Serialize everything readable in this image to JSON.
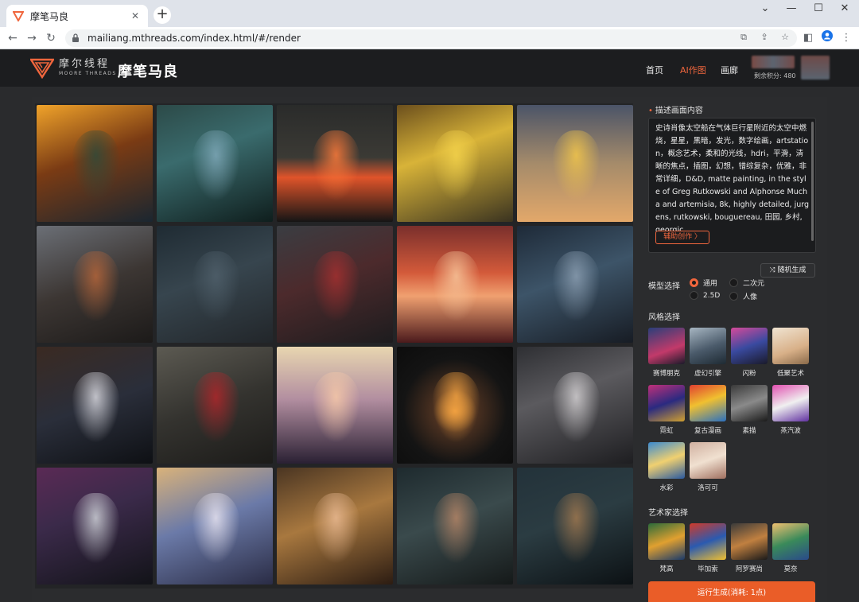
{
  "browser": {
    "tab_title": "摩笔马良",
    "url": "mailiang.mthreads.com/index.html/#/render",
    "new_tab": "+",
    "close": "✕"
  },
  "header": {
    "logo_cn": "摩尔线程",
    "logo_en": "MOORE THREADS",
    "brand": "摩笔马良",
    "nav": [
      "首页",
      "AI作图",
      "画廊"
    ],
    "active_nav": "AI作图",
    "points": "剩余积分: 480"
  },
  "gallery": {
    "tiles": [
      {
        "name": "spaceship-lady",
        "bg": "linear-gradient(160deg,#f0a32a 0%,#7a3b14 45%,#1a2630 100%)",
        "accent": "#2f4a3a"
      },
      {
        "name": "blue-hair-elf",
        "bg": "linear-gradient(160deg,#2c4a48 0%,#3a6b6d 40%,#0f1e1d 100%)",
        "accent": "#7fa8b8"
      },
      {
        "name": "burning-city",
        "bg": "linear-gradient(180deg,#2a2b2a 0%,#3b3a35 45%,#e0542a 62%,#151515 100%)",
        "accent": "#ff7b3a"
      },
      {
        "name": "yellow-robots",
        "bg": "linear-gradient(160deg,#6b4f1d 0%,#d8b338 40%,#3a3320 100%)",
        "accent": "#f3d24b"
      },
      {
        "name": "golden-tree",
        "bg": "linear-gradient(180deg,#4b5468 0%,#a58b6a 50%,#e3a86a 100%)",
        "accent": "#f3c64a"
      },
      {
        "name": "deer-girl",
        "bg": "linear-gradient(160deg,#6b6f76 0%,#3c3633 50%,#1c1a19 100%)",
        "accent": "#b4653a"
      },
      {
        "name": "beanie-girl",
        "bg": "linear-gradient(160deg,#1f2b33 0%,#37454e 45%,#22262a 100%)",
        "accent": "#4f5f6a"
      },
      {
        "name": "red-armor-hero",
        "bg": "linear-gradient(160deg,#3a3d42 0%,#4c2a2c 45%,#1d1c1e 100%)",
        "accent": "#a33030"
      },
      {
        "name": "red-forest",
        "bg": "linear-gradient(180deg,#7a2f2c 0%,#d35a3a 40%,#f0a070 60%,#4b1a1c 100%)",
        "accent": "#f6c59a"
      },
      {
        "name": "space-woman",
        "bg": "linear-gradient(160deg,#1e2a38 0%,#3d5468 45%,#171c24 100%)",
        "accent": "#8a9db0"
      },
      {
        "name": "raccoon",
        "bg": "linear-gradient(160deg,#3a2a22 0%,#2a2e3a 50%,#0e1014 100%)",
        "accent": "#d9d9e0"
      },
      {
        "name": "armored-cat",
        "bg": "linear-gradient(160deg,#5c5a52 0%,#34332f 50%,#1c1b19 100%)",
        "accent": "#b0262a"
      },
      {
        "name": "hourglass",
        "bg": "linear-gradient(180deg,#e8d6b0 0%,#b28ea0 45%,#2a2033 100%)",
        "accent": "#f7c9a8"
      },
      {
        "name": "portal-dial",
        "bg": "radial-gradient(circle at 50% 55%,#f0a040 0%,#4a3020 25%,#141414 60%,#0c0c0c 100%)",
        "accent": "#f0a040"
      },
      {
        "name": "silver-hair-knight",
        "bg": "linear-gradient(160deg,#2e2f33 0%,#5b5a5e 40%,#1e1e21 100%)",
        "accent": "#d3d0d2"
      },
      {
        "name": "silver-hair-man",
        "bg": "linear-gradient(160deg,#5a2a55 0%,#3b2a4a 40%,#121318 100%)",
        "accent": "#cfd2d8"
      },
      {
        "name": "window-elf",
        "bg": "linear-gradient(160deg,#d9b27a 0%,#6b7aa8 45%,#2a2c45 100%)",
        "accent": "#e8e4f0"
      },
      {
        "name": "book-girl",
        "bg": "linear-gradient(160deg,#4a3522 0%,#a8783f 45%,#2c1c12 100%)",
        "accent": "#e9b992"
      },
      {
        "name": "bearded-man",
        "bg": "linear-gradient(160deg,#1e2a2e 0%,#3a4a4c 45%,#151919 100%)",
        "accent": "#b58566"
      },
      {
        "name": "cat-ear-girl",
        "bg": "linear-gradient(160deg,#23323a 0%,#2b3c42 45%,#0c1114 100%)",
        "accent": "#a0784f"
      }
    ]
  },
  "panel": {
    "prompt_title": "描述画面内容",
    "prompt_text": "史诗肖像太空船在气体巨行星附近的太空中燃烧，星星，黑暗，发光，数字绘画，artstation，概念艺术，柔和的光线，hdri，平滑，清晰的焦点，插图，幻想，错综复杂，优雅，非常详细，D&D, matte painting, in the style of Greg Rutkowski and Alphonse Mucha and artemisia, 8k, highly detailed, jurgens, rutkowski, bouguereau, 田园, 乡村, georgic",
    "assist_label": "辅助创作 〉",
    "random_label": "⤨ 随机生成",
    "model_title": "模型选择",
    "models": [
      "通用",
      "二次元",
      "2.5D",
      "人像"
    ],
    "selected_model": "通用",
    "style_title": "风格选择",
    "styles": [
      {
        "label": "赛博朋克",
        "bg": "linear-gradient(160deg,#2a3f7a,#c23a6a 60%,#1a1a2a)"
      },
      {
        "label": "虚幻引擎",
        "bg": "linear-gradient(160deg,#a7b6c2,#4a5a6a 55%,#1e2a33)"
      },
      {
        "label": "闪粉",
        "bg": "linear-gradient(160deg,#d54a9a,#3a4aa0 50%,#1a1a2a)"
      },
      {
        "label": "低聚艺术",
        "bg": "linear-gradient(160deg,#f0e4d2,#d8b088 60%,#8a6a4a)"
      },
      {
        "label": "霓虹",
        "bg": "linear-gradient(160deg,#c0307a,#2a2a80 50%,#d0a030)"
      },
      {
        "label": "复古漫画",
        "bg": "linear-gradient(160deg,#e04030,#f0c030 45%,#2a70c0)"
      },
      {
        "label": "素描",
        "bg": "linear-gradient(160deg,#3a3a3a,#8a8a8a 50%,#1a1a1a)"
      },
      {
        "label": "蒸汽波",
        "bg": "linear-gradient(160deg,#e050b0,#f0f0f0 50%,#6030a0)"
      },
      {
        "label": "水彩",
        "bg": "linear-gradient(160deg,#3a8ad0,#f0d070 50%,#2a5aa0)"
      },
      {
        "label": "洛可可",
        "bg": "linear-gradient(160deg,#d0b0a0,#f0e0d0 50%,#a07060)"
      }
    ],
    "artist_title": "艺术家选择",
    "artists": [
      {
        "label": "梵高",
        "bg": "linear-gradient(160deg,#2a6a3a,#e0a030 50%,#1a3a6a)"
      },
      {
        "label": "毕加索",
        "bg": "linear-gradient(160deg,#d03a2a,#2a5ab0 50%,#f0c030)"
      },
      {
        "label": "阿罗赛尚",
        "bg": "linear-gradient(160deg,#3a3a3a,#c08040 50%,#1a1a1a)"
      },
      {
        "label": "莫奈",
        "bg": "linear-gradient(160deg,#f0c070,#3a8a5a 50%,#2a4a8a)"
      }
    ],
    "run_label": "运行生成(消耗: 1点)"
  },
  "colors": {
    "accent": "#f0663d",
    "run_button": "#ea5d28"
  }
}
